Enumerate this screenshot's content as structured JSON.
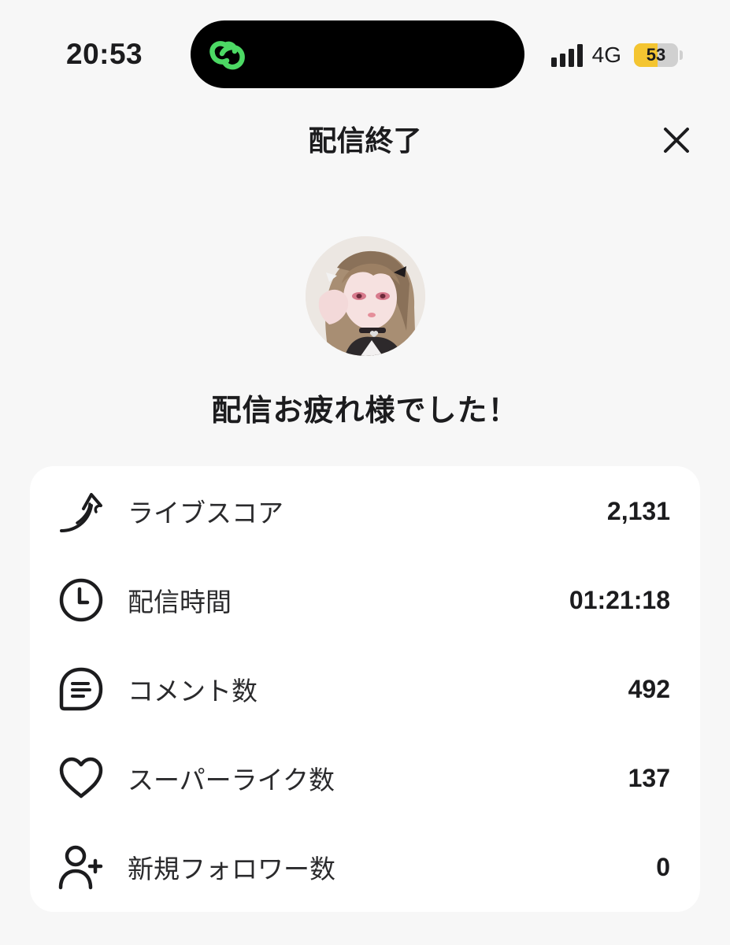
{
  "status_bar": {
    "time": "20:53",
    "network": "4G",
    "battery_level": "53",
    "battery_fraction": 0.53,
    "island_icon": "link-rings-icon",
    "accent_color": "#4cd964"
  },
  "header": {
    "title": "配信終了",
    "close_icon": "close-icon"
  },
  "greeting": "配信お疲れ様でした！",
  "stats": [
    {
      "icon": "arrow-up-icon",
      "label": "ライブスコア",
      "value": "2,131"
    },
    {
      "icon": "clock-icon",
      "label": "配信時間",
      "value": "01:21:18"
    },
    {
      "icon": "comment-icon",
      "label": "コメント数",
      "value": "492"
    },
    {
      "icon": "heart-icon",
      "label": "スーパーライク数",
      "value": "137"
    },
    {
      "icon": "add-user-icon",
      "label": "新規フォロワー数",
      "value": "0"
    }
  ]
}
